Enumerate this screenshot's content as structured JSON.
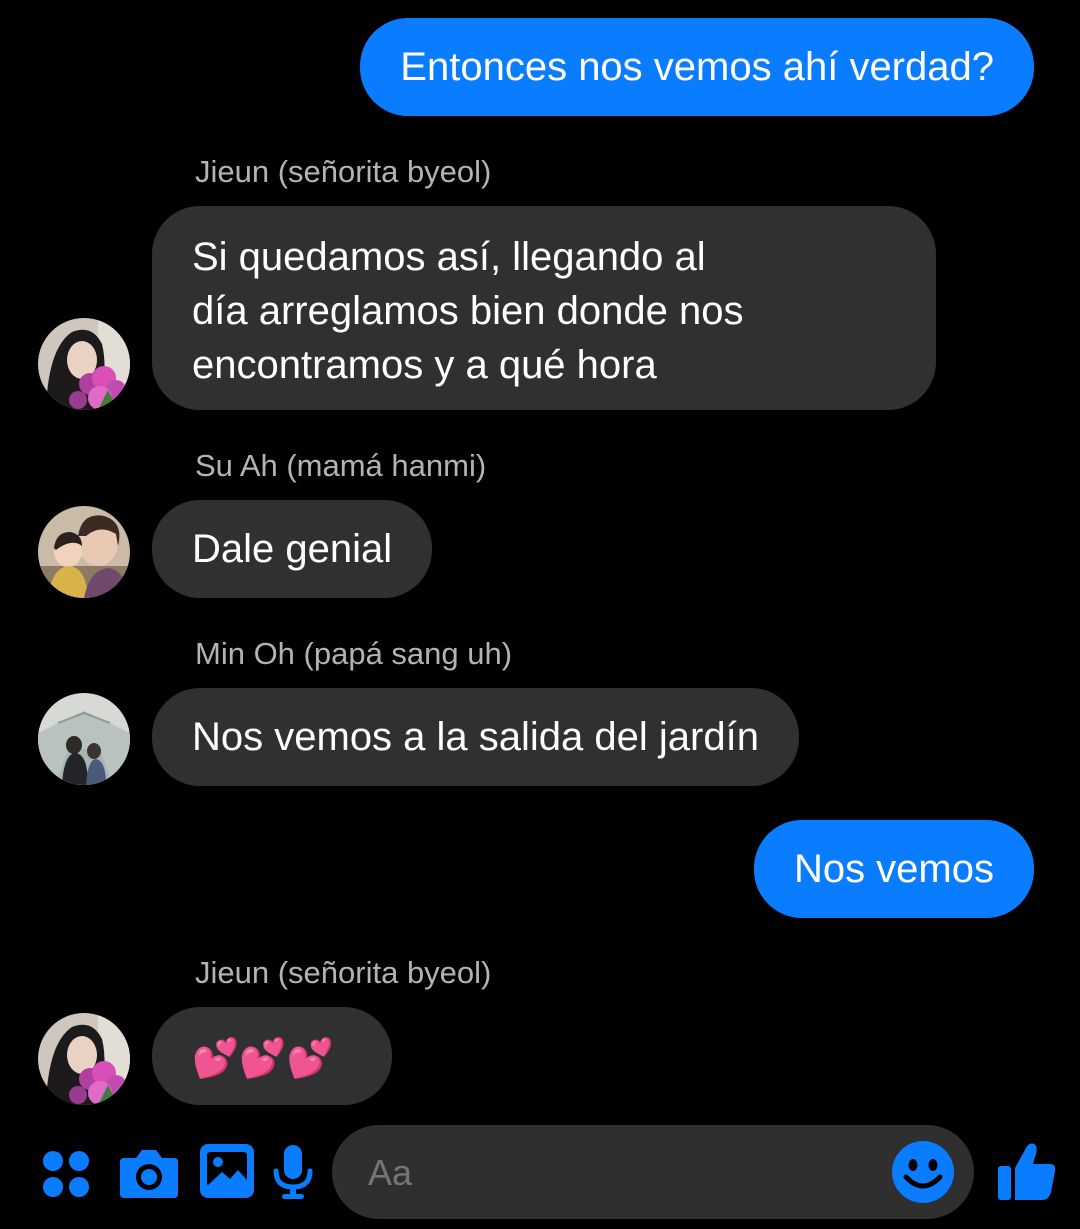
{
  "messages": [
    {
      "type": "outgoing",
      "text": "Entonces nos vemos ahí verdad?"
    },
    {
      "type": "incoming",
      "sender": "Jieun (señorita byeol)",
      "lines": [
        "Si quedamos así, llegando al",
        "día arreglamos bien donde nos",
        "encontramos y a qué hora"
      ]
    },
    {
      "type": "incoming",
      "sender": "Su Ah (mamá hanmi)",
      "text": "Dale genial"
    },
    {
      "type": "incoming",
      "sender": "Min Oh (papá sang uh)",
      "text": "Nos vemos a la salida del jardín"
    },
    {
      "type": "outgoing",
      "text": "Nos vemos"
    },
    {
      "type": "incoming",
      "sender": "Jieun (señorita byeol)",
      "text": "💕💕💕"
    }
  ],
  "composer": {
    "placeholder": "Aa",
    "icons": [
      "apps-grid-icon",
      "camera-icon",
      "gallery-icon",
      "microphone-icon",
      "emoji-icon",
      "thumbs-up-icon"
    ]
  },
  "colors": {
    "accent": "#0a7cff",
    "incoming_bubble": "#303030",
    "background": "#000000",
    "secondary_text": "#b0b3b8"
  }
}
